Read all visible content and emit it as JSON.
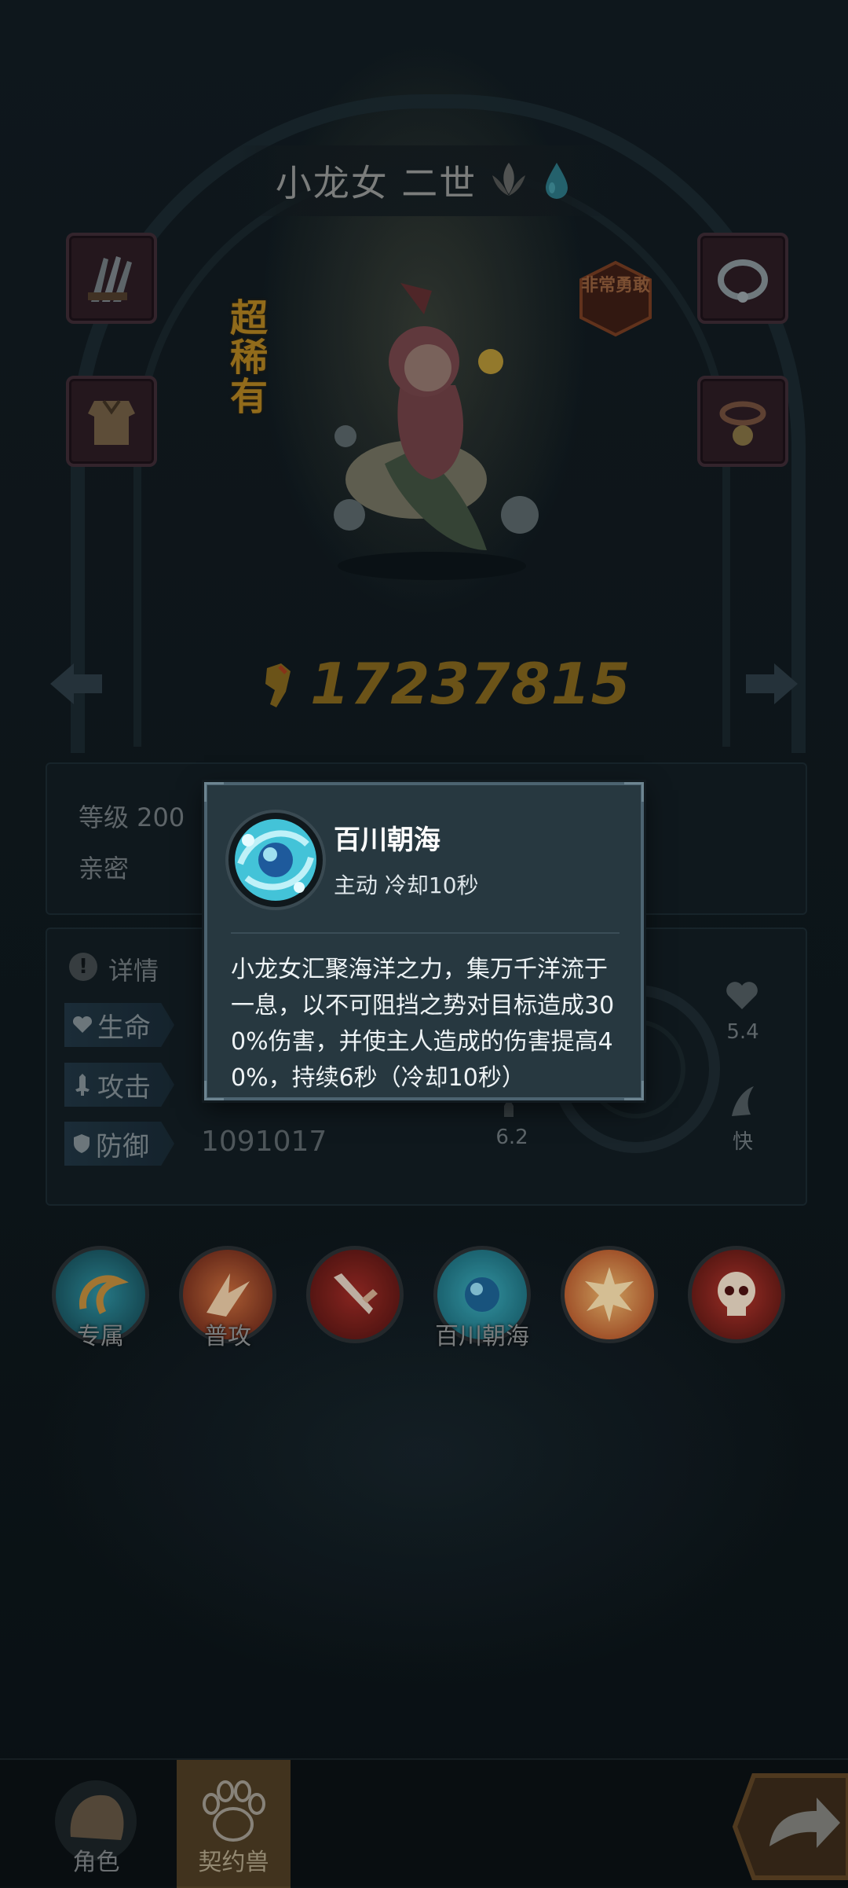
{
  "hero": {
    "name": "小龙女 二世",
    "rarity": "超稀有",
    "trait": "非常勇敢",
    "power": "17237815"
  },
  "info": {
    "level_label": "等级 200",
    "intimacy_label": "亲密"
  },
  "stats": {
    "details_label": "详情",
    "hp_label": "生命",
    "attack_label": "攻击",
    "defense_label": "防御",
    "defense_value": "1091017",
    "right_hp_value": "5.4",
    "speed_value": "6.2",
    "speed_label": "快"
  },
  "skills": {
    "exclusive_label": "专属",
    "normal_attack_label": "普攻",
    "skill4_label": "百川朝海"
  },
  "popup": {
    "title": "百川朝海",
    "subtitle": "主动  冷却10秒",
    "description": "小龙女汇聚海洋之力，集万千洋流于一息，以不可阻挡之势对目标造成300%伤害，并使主人造成的伤害提高40%，持续6秒（冷却10秒）"
  },
  "bottom_nav": {
    "role_label": "角色",
    "pet_label": "契约兽"
  },
  "colors": {
    "popup_bg": "#273840",
    "popup_border": "#4c6370",
    "power_gold": "#7a5f1c",
    "rarity_gold": "#a67a1f"
  }
}
